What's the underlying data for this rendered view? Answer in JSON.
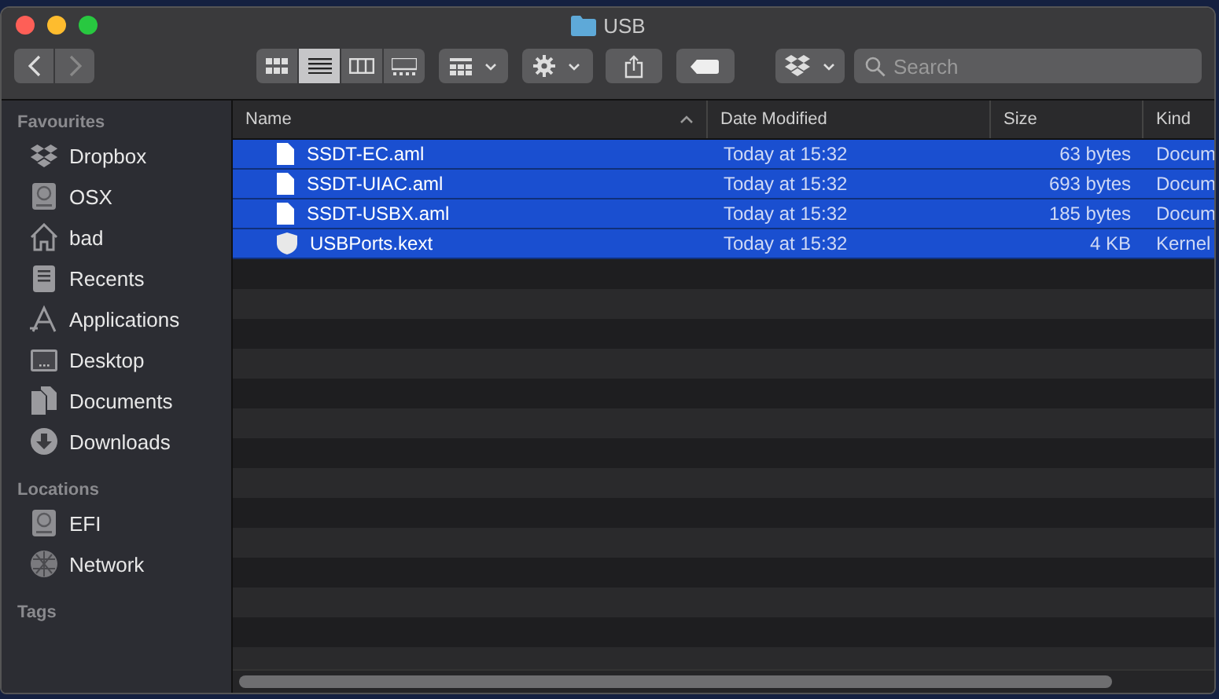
{
  "window": {
    "title": "USB"
  },
  "toolbar": {
    "view_modes": [
      {
        "kind": "icons",
        "selected": false
      },
      {
        "kind": "list",
        "selected": true
      },
      {
        "kind": "columns",
        "selected": false
      },
      {
        "kind": "gallery",
        "selected": false
      }
    ],
    "search": {
      "placeholder": "Search"
    }
  },
  "sidebar": {
    "sections": [
      {
        "title": "Favourites",
        "items": [
          {
            "label": "Dropbox",
            "kind": "dropbox"
          },
          {
            "label": "OSX",
            "kind": "disk"
          },
          {
            "label": "bad",
            "kind": "home"
          },
          {
            "label": "Recents",
            "kind": "recents"
          },
          {
            "label": "Applications",
            "kind": "apps"
          },
          {
            "label": "Desktop",
            "kind": "desktop"
          },
          {
            "label": "Documents",
            "kind": "documents"
          },
          {
            "label": "Downloads",
            "kind": "downloads"
          }
        ]
      },
      {
        "title": "Locations",
        "items": [
          {
            "label": "EFI",
            "kind": "disk"
          },
          {
            "label": "Network",
            "kind": "network"
          }
        ]
      },
      {
        "title": "Tags"
      }
    ]
  },
  "table": {
    "columns": [
      {
        "label": "Name",
        "sorted": true
      },
      {
        "label": "Date Modified",
        "sorted": false
      },
      {
        "label": "Size",
        "sorted": false
      },
      {
        "label": "Kind",
        "sorted": false
      }
    ],
    "rows": [
      {
        "name": "SSDT-EC.aml",
        "kind": "document",
        "date": "Today at 15:32",
        "size": "63 bytes",
        "kind_label": "Docum",
        "selected": true
      },
      {
        "name": "SSDT-UIAC.aml",
        "kind": "document",
        "date": "Today at 15:32",
        "size": "693 bytes",
        "kind_label": "Docum",
        "selected": true
      },
      {
        "name": "SSDT-USBX.aml",
        "kind": "document",
        "date": "Today at 15:32",
        "size": "185 bytes",
        "kind_label": "Docum",
        "selected": true
      },
      {
        "name": "USBPorts.kext",
        "kind": "kext",
        "date": "Today at 15:32",
        "size": "4 KB",
        "kind_label": "Kernel",
        "selected": true
      }
    ]
  }
}
